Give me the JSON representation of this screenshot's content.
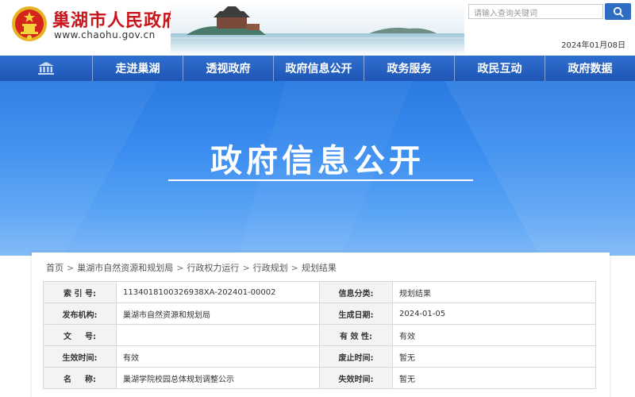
{
  "header": {
    "title": "巢湖市人民政府",
    "url": "www.chaohu.gov.cn",
    "search_placeholder": "请输入查询关键词",
    "date": "2024年01月08日",
    "emblem_icon": "national-emblem-icon",
    "search_icon": "search-icon"
  },
  "nav": {
    "home_icon": "building-icon",
    "items": [
      {
        "label": "走进巢湖"
      },
      {
        "label": "透视政府"
      },
      {
        "label": "政府信息公开"
      },
      {
        "label": "政务服务"
      },
      {
        "label": "政民互动"
      },
      {
        "label": "政府数据"
      }
    ]
  },
  "banner": {
    "title": "政府信息公开"
  },
  "breadcrumb": [
    "首页",
    "巢湖市自然资源和规划局",
    "行政权力运行",
    "行政规划",
    "规划结果"
  ],
  "breadcrumb_separator": ">",
  "meta": {
    "rows": [
      {
        "l1": "索 引 号:",
        "v1": "1134018100326938XA-202401-00002",
        "l2": "信息分类:",
        "v2": "规划结果"
      },
      {
        "l1": "发布机构:",
        "v1": "巢湖市自然资源和规划局",
        "l2": "生成日期:",
        "v2": "2024-01-05"
      },
      {
        "l1": "文 　 号:",
        "v1": "",
        "l2": "有 效 性:",
        "v2": "有效"
      },
      {
        "l1": "生效时间:",
        "v1": "有效",
        "l2": "废止时间:",
        "v2": "暂无"
      },
      {
        "l1": "名 　 称:",
        "v1": "巢湖学院校园总体规划调整公示",
        "l2": "失效时间:",
        "v2": "暂无"
      }
    ]
  },
  "colors": {
    "brand_red": "#c8161d",
    "nav_blue": "#2463c4",
    "banner_blue": "#3b8df0"
  }
}
